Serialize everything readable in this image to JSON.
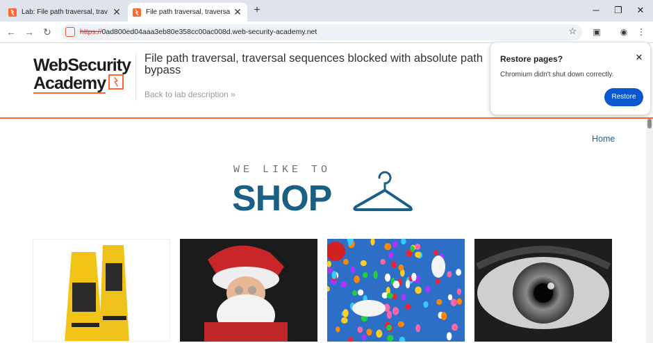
{
  "browser": {
    "tabs": [
      {
        "title": "Lab: File path traversal, traversal"
      },
      {
        "title": "File path traversal, traversal seq"
      }
    ],
    "new_tab": "+",
    "close": "✕",
    "window": {
      "minimize": "─",
      "restore": "❐",
      "close": "✕"
    },
    "address": {
      "scheme": "https://",
      "rest": "0ad800ed04aaa3eb80e358cc00ac008d.web-security-academy.net"
    }
  },
  "banner": {
    "logo_line1": "WebSecurity",
    "logo_line2": "Academy",
    "lab_title": "File path traversal, traversal sequences blocked with absolute path bypass",
    "back_link": "Back to lab description »"
  },
  "shop": {
    "nav_home": "Home",
    "tagline_small": "WE LIKE TO",
    "tagline_big": "SHOP"
  },
  "products": [
    {
      "icon": "wet-floor-signs-image"
    },
    {
      "icon": "santa-with-lights-image"
    },
    {
      "icon": "balloons-and-dogs-image"
    },
    {
      "icon": "eye-closeup-image"
    }
  ],
  "restore_popup": {
    "title": "Restore pages?",
    "message": "Chromium didn't shut down correctly.",
    "button": "Restore"
  },
  "colors": {
    "brand_orange": "#ff6633",
    "shop_blue": "#1a5f86",
    "restore_button": "#0b57d0"
  }
}
